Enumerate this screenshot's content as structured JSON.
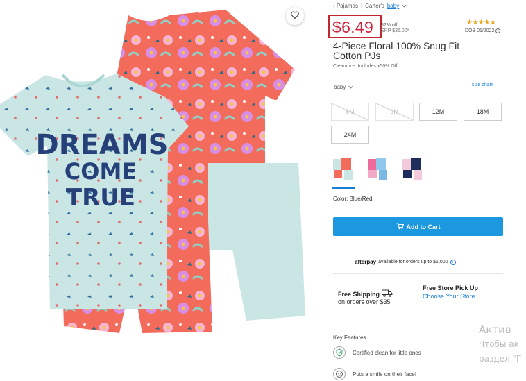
{
  "breadcrumb": {
    "item1": "‹ Pajamas",
    "sep": "|",
    "item2": "Carter's",
    "item3": "baby"
  },
  "price": {
    "current": "$6.49",
    "discount": "82% off",
    "srp_label": "SRP",
    "srp_value": "$36.00*"
  },
  "rating": {
    "stars": "★★★★★",
    "dob": "DOB 01/2022"
  },
  "product": {
    "title": "4-Piece Floral 100% Snug Fit Cotton PJs",
    "clearance": "Clearance: Includes x50% Off",
    "image_text": "DREAMS COME TRUE"
  },
  "sizes": {
    "type_label": "baby",
    "chart_link": "size chart",
    "options": [
      {
        "label": "6M",
        "available": false
      },
      {
        "label": "9M",
        "available": false
      },
      {
        "label": "12M",
        "available": true
      },
      {
        "label": "18M",
        "available": true
      },
      {
        "label": "24M",
        "available": true
      }
    ]
  },
  "color": {
    "label": "Color: Blue/Red"
  },
  "cart": {
    "button_label": "Add to Cart"
  },
  "afterpay": {
    "logo": "afterpay",
    "text": "available for orders up to $1,000"
  },
  "shipping": {
    "free_title": "Free Shipping",
    "free_sub": "on orders over $35",
    "pickup_title": "Free Store Pick Up",
    "pickup_link": "Choose Your Store"
  },
  "features": {
    "heading": "Key Features",
    "items": [
      "Certified clean for little ones",
      "Puts a smile on their face!"
    ]
  },
  "watermark": {
    "line1": "Актив",
    "line2": "Чтобы ак",
    "line3": "раздел \"Г"
  },
  "colors": {
    "accent": "#1b98e0",
    "price_red": "#d3203a",
    "highlight_box": "#c0282d",
    "star": "#e6a317"
  }
}
